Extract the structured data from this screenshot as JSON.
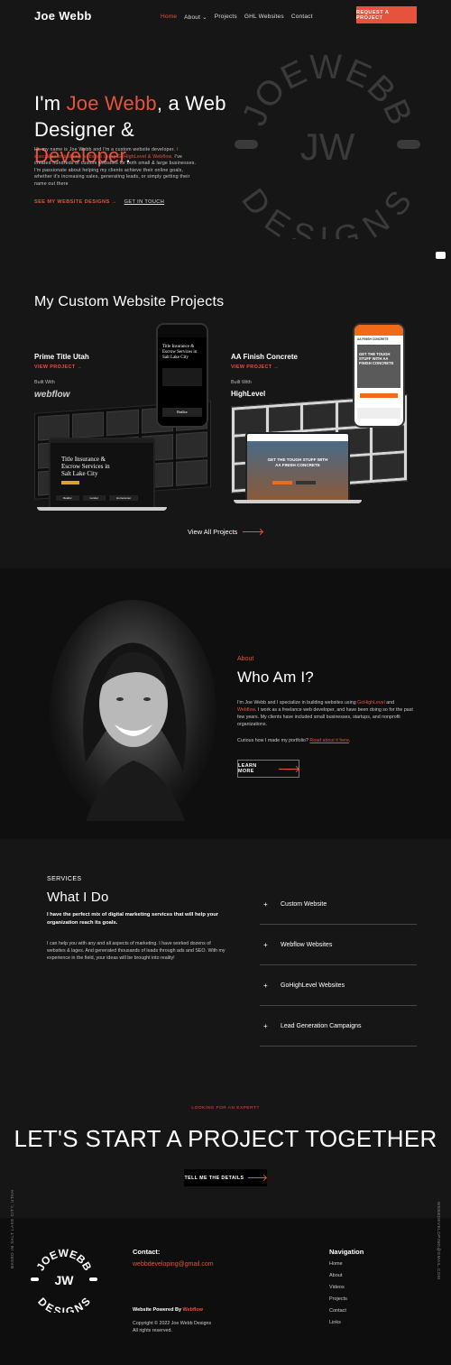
{
  "header": {
    "logo": "Joe Webb",
    "nav": [
      {
        "label": "Home",
        "active": true
      },
      {
        "label": "About ⌄",
        "active": false
      },
      {
        "label": "Projects",
        "active": false
      },
      {
        "label": "GHL Websites",
        "active": false
      },
      {
        "label": "Contact",
        "active": false
      }
    ],
    "cta": "REQUEST A PROJECT"
  },
  "hero": {
    "title_pre": "I'm ",
    "title_name": "Joe Webb",
    "title_mid": ", a Web Designer &",
    "title_role": "Developer",
    "title_end": ".",
    "text_1": "Hi, my name is Joe Webb and I'm a custom website developer. ",
    "text_accent": "I specialize in building websites using GoHighLevel & Webflow.",
    "text_2": " I've created hundreds of custom websites for both small & large businesses. I'm passionate about helping my clients achieve their online goals, whether it's increasing sales, generating leads, or simply getting their name out there",
    "link_primary": "SEE MY WEBSITE DESIGNS →",
    "link_secondary": "GET IN TOUCH",
    "badge_top": "JOEWEBB",
    "badge_center": "JW",
    "badge_bottom": "DESIGNS"
  },
  "projects": {
    "title": "My Custom Website Projects",
    "items": [
      {
        "name": "Prime Title Utah",
        "link": "VIEW PROJECT    →",
        "built_with": "Built With",
        "platform": "webflow",
        "mock_title": "Title Insurance & Escrow Services in Salt Lake City",
        "mock_cards": [
          "Realtor",
          "Lender",
          "Homeowner"
        ],
        "phone_btn": "Realtor"
      },
      {
        "name": "AA Finish Concrete",
        "link": "VIEW PROJECT    →",
        "built_with": "Built With",
        "platform": "HighLevel",
        "mock_title": "GET THE TOUGH STUFF WITH AA FINISH CONCRETE",
        "phone_header": "AA FINISH CONCRETE",
        "phone_title": "GET THE TOUGH STUFF WITH AA FINISH CONCRETE"
      }
    ],
    "view_all": "View All Projects"
  },
  "about": {
    "eyebrow": "About",
    "title": "Who Am I?",
    "text_1": "I'm Joe Webb and I specialize in building websites using ",
    "ghl": "GoHighLevel",
    "text_2": " and ",
    "webflow": "Webflow",
    "text_3": ". I work as a freelance web developer, and have been doing so for the past few years. My clients have included small businesses, startups, and nonprofit organizations.",
    "question": "Curious how I made my portfolio? ",
    "question_link": "Read about it here",
    "question_end": ".",
    "button": "LEARN MORE"
  },
  "services": {
    "eyebrow": "SERVICES",
    "title": "What I Do",
    "subtitle": "I have the perfect mix of digital marketing services that will help your organization reach its goals.",
    "text": "I can help you with any and all aspects of marketing. I have worked dozens of websites & lages. And generated thousands of leads through ads and SEO. With my experience in the field, your ideas will be brought into reality!",
    "items": [
      "Custom Website",
      "Webflow Websites",
      "GoHighLevel Websites",
      "Lead Generation Campaigns"
    ]
  },
  "cta": {
    "eyebrow": "LOOKING FOR AN EXPERT?",
    "title": "LET'S START A PROJECT TOGETHER",
    "button": "TELL ME THE DETAILS"
  },
  "side": {
    "left": "BASED IN SALT LAKE CITY, UTAH",
    "right": "WEBBDEVELOPING@GMAIL.COM"
  },
  "footer": {
    "contact_heading": "Contact:",
    "email": "webbdeveloping@gmail.com",
    "powered_prefix": "Website Powered By ",
    "powered_link": "Webflow",
    "copyright": "Copyright © 2022 Joe Webb Designs",
    "rights": "All rights reserved.",
    "nav_heading": "Navigation",
    "nav": [
      "Home",
      "About",
      "Videos",
      "Projects",
      "Contact",
      "Links"
    ]
  },
  "colors": {
    "accent": "#e5533d",
    "background": "#161616",
    "gold": "#d7a52a"
  }
}
